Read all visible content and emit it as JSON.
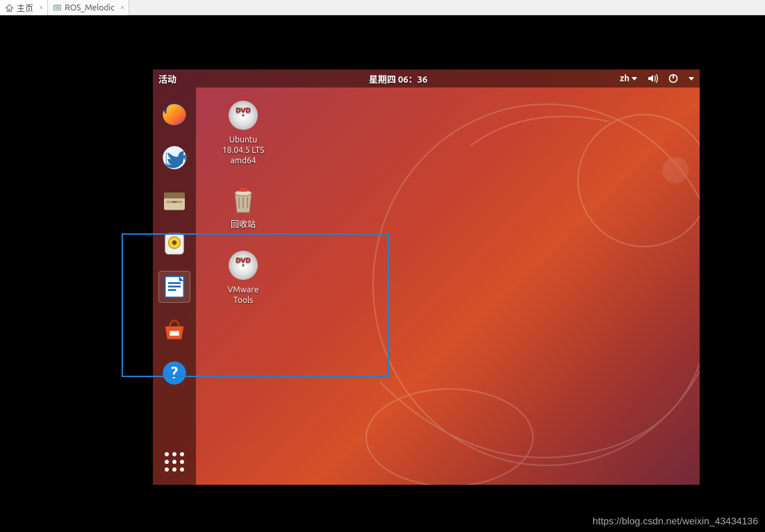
{
  "host_tabs": [
    {
      "label": "主页",
      "icon": "home-icon"
    },
    {
      "label": "ROS_Melodic",
      "icon": "vm-icon"
    }
  ],
  "topbar": {
    "activities": "活动",
    "clock": "星期四 06：36",
    "lang": "zh"
  },
  "dock": {
    "items": [
      {
        "name": "firefox"
      },
      {
        "name": "thunderbird"
      },
      {
        "name": "files"
      },
      {
        "name": "rhythmbox"
      },
      {
        "name": "libreoffice-writer"
      },
      {
        "name": "ubuntu-software"
      },
      {
        "name": "help"
      }
    ]
  },
  "desktop_icons": [
    {
      "name": "dvd-ubuntu",
      "label": "Ubuntu\n18.04.5 LTS\namd64"
    },
    {
      "name": "trash",
      "label": "回收站"
    },
    {
      "name": "dvd-vmware",
      "label": "VMware\nTools"
    }
  ],
  "watermark": "https://blog.csdn.net/weixin_43434136"
}
